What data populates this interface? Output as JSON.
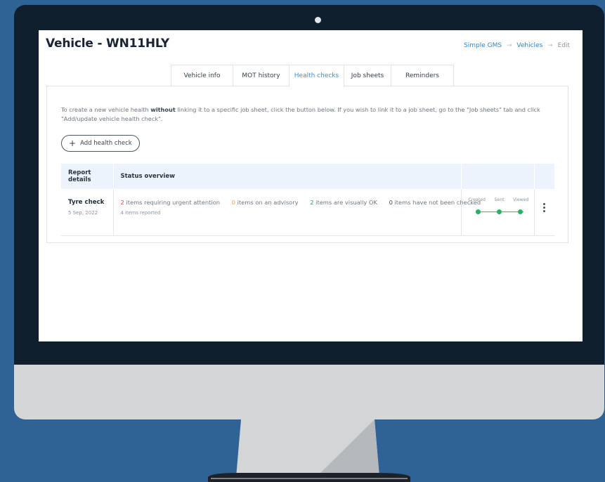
{
  "page": {
    "title": "Vehicle - WN11HLY",
    "breadcrumb": [
      "Simple GMS",
      "Vehicles",
      "Edit"
    ]
  },
  "tabs": [
    {
      "label": "Vehicle info",
      "active": false
    },
    {
      "label": "MOT history",
      "active": false
    },
    {
      "label": "Health checks",
      "active": true
    },
    {
      "label": "Job sheets",
      "active": false
    },
    {
      "label": "Reminders",
      "active": false
    }
  ],
  "health_checks": {
    "intro_before": "To create a new vehicle health ",
    "intro_bold": "without",
    "intro_after": " linking it to a specific job sheet, click the button below. If you wish to link it to a job sheet, go to the \"Job sheets\" tab and click \"Add/update vehicle health check\".",
    "add_button_label": "Add health check",
    "columns": [
      "Report details",
      "Status overview",
      "",
      ""
    ],
    "rows": [
      {
        "name": "Tyre check",
        "date": "5 Sep, 2022",
        "urgent_count": "2",
        "urgent_text": " items requiring urgent attention",
        "advisory_count": "0",
        "advisory_text": " items on an advisory",
        "ok_count": "2",
        "ok_text": " items are visually OK",
        "unchecked_count": "0",
        "unchecked_text": " items have not been checked",
        "items_reported": "4 items reported",
        "progress": [
          "Created",
          "Sent",
          "Viewed"
        ]
      }
    ]
  },
  "colors": {
    "accent": "#3b8ed0",
    "urgent": "#e0443c",
    "advisory": "#f2a531",
    "ok": "#27a35f",
    "progress": "#22b463",
    "table_header_bg": "#edf3fc"
  },
  "icons": {
    "add": "plus-icon",
    "breadcrumb_separator": "arrow-right-icon",
    "row_menu": "kebab-menu-icon"
  }
}
